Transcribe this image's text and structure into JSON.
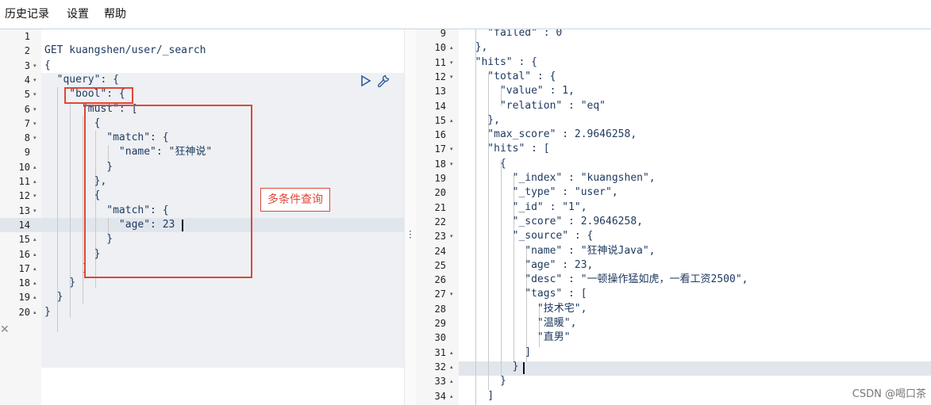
{
  "menu": [
    "历史记录",
    "设置",
    "帮助"
  ],
  "left_lines": [
    {
      "n": "1",
      "fold": "",
      "text": ""
    },
    {
      "n": "2",
      "fold": "",
      "text": "GET kuangshen/user/_search"
    },
    {
      "n": "3",
      "fold": "▾",
      "text": "{"
    },
    {
      "n": "4",
      "fold": "▾",
      "text": "  \"query\": {"
    },
    {
      "n": "5",
      "fold": "▾",
      "text": "    \"bool\": {"
    },
    {
      "n": "6",
      "fold": "▾",
      "text": "      \"must\": ["
    },
    {
      "n": "7",
      "fold": "▾",
      "text": "        {"
    },
    {
      "n": "8",
      "fold": "▾",
      "text": "          \"match\": {"
    },
    {
      "n": "9",
      "fold": "",
      "text": "            \"name\": \"狂神说\""
    },
    {
      "n": "10",
      "fold": "▴",
      "text": "          }"
    },
    {
      "n": "11",
      "fold": "▴",
      "text": "        },"
    },
    {
      "n": "12",
      "fold": "▾",
      "text": "        {"
    },
    {
      "n": "13",
      "fold": "▾",
      "text": "          \"match\": {"
    },
    {
      "n": "14",
      "fold": "",
      "text": "            \"age\": 23"
    },
    {
      "n": "15",
      "fold": "▴",
      "text": "          }"
    },
    {
      "n": "16",
      "fold": "▴",
      "text": "        }"
    },
    {
      "n": "17",
      "fold": "▴",
      "text": "      ]"
    },
    {
      "n": "18",
      "fold": "▴",
      "text": "    }"
    },
    {
      "n": "19",
      "fold": "▴",
      "text": "  }"
    },
    {
      "n": "20",
      "fold": "▴",
      "text": "}"
    }
  ],
  "right_lines": [
    {
      "n": "9",
      "fold": "",
      "text": "    \"failed\" : 0"
    },
    {
      "n": "10",
      "fold": "▴",
      "text": "  },"
    },
    {
      "n": "11",
      "fold": "▾",
      "text": "  \"hits\" : {"
    },
    {
      "n": "12",
      "fold": "▾",
      "text": "    \"total\" : {"
    },
    {
      "n": "13",
      "fold": "",
      "text": "      \"value\" : 1,"
    },
    {
      "n": "14",
      "fold": "",
      "text": "      \"relation\" : \"eq\""
    },
    {
      "n": "15",
      "fold": "▴",
      "text": "    },"
    },
    {
      "n": "16",
      "fold": "",
      "text": "    \"max_score\" : 2.9646258,"
    },
    {
      "n": "17",
      "fold": "▾",
      "text": "    \"hits\" : ["
    },
    {
      "n": "18",
      "fold": "▾",
      "text": "      {"
    },
    {
      "n": "19",
      "fold": "",
      "text": "        \"_index\" : \"kuangshen\","
    },
    {
      "n": "20",
      "fold": "",
      "text": "        \"_type\" : \"user\","
    },
    {
      "n": "21",
      "fold": "",
      "text": "        \"_id\" : \"1\","
    },
    {
      "n": "22",
      "fold": "",
      "text": "        \"_score\" : 2.9646258,"
    },
    {
      "n": "23",
      "fold": "▾",
      "text": "        \"_source\" : {"
    },
    {
      "n": "24",
      "fold": "",
      "text": "          \"name\" : \"狂神说Java\","
    },
    {
      "n": "25",
      "fold": "",
      "text": "          \"age\" : 23,"
    },
    {
      "n": "26",
      "fold": "",
      "text": "          \"desc\" : \"一顿操作猛如虎，一看工资2500\","
    },
    {
      "n": "27",
      "fold": "▾",
      "text": "          \"tags\" : ["
    },
    {
      "n": "28",
      "fold": "",
      "text": "            \"技术宅\","
    },
    {
      "n": "29",
      "fold": "",
      "text": "            \"温暖\","
    },
    {
      "n": "30",
      "fold": "",
      "text": "            \"直男\""
    },
    {
      "n": "31",
      "fold": "▴",
      "text": "          ]"
    },
    {
      "n": "32",
      "fold": "▴",
      "text": "        }"
    },
    {
      "n": "33",
      "fold": "▴",
      "text": "      }"
    },
    {
      "n": "34",
      "fold": "▴",
      "text": "    ]"
    }
  ],
  "annotation": "多条件查询",
  "watermark": "CSDN @喝口茶",
  "colors": {
    "accent_red": "#e0463a",
    "code": "#1f3a60"
  }
}
